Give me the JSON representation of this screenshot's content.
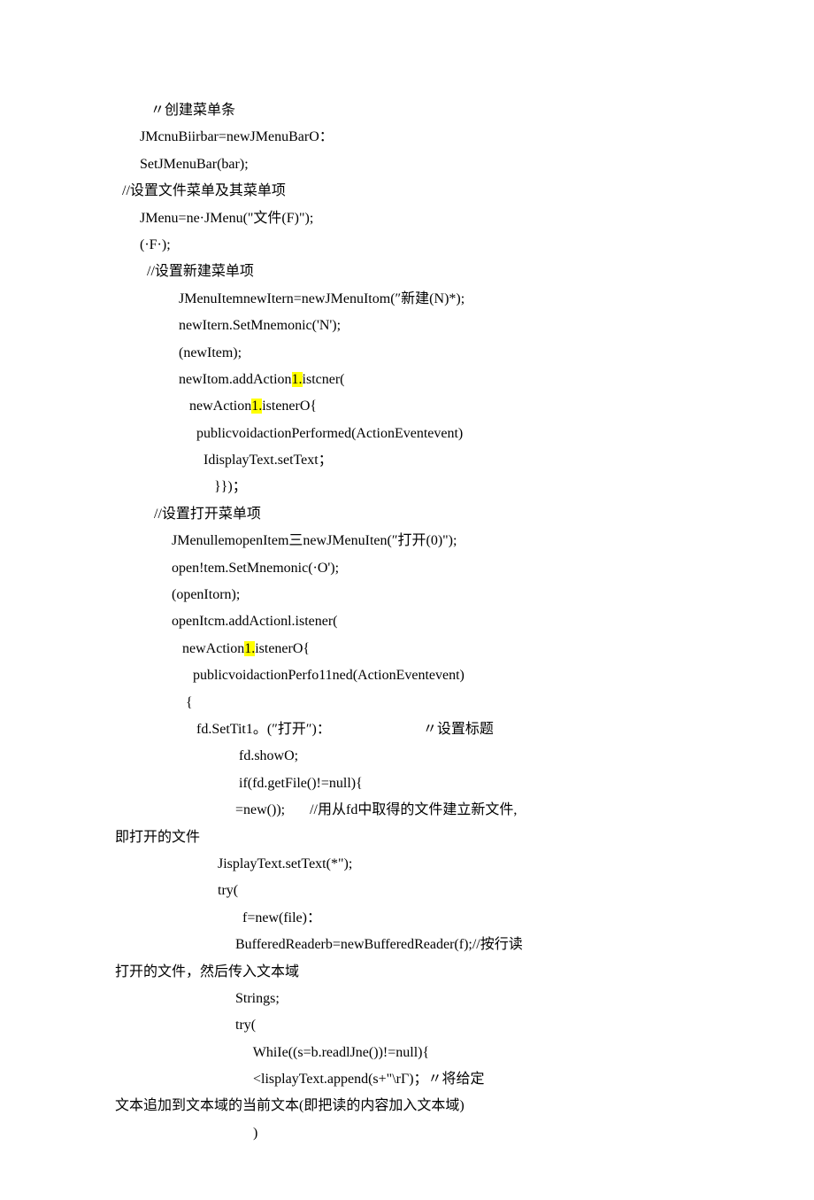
{
  "lines": [
    {
      "indent": "          ",
      "segments": [
        {
          "t": "〃创建菜单条"
        }
      ]
    },
    {
      "indent": "       ",
      "segments": [
        {
          "t": "JMcnuBiirbar=newJMenuBarO："
        }
      ]
    },
    {
      "indent": "       ",
      "segments": [
        {
          "t": "SetJMenuBar(bar);"
        }
      ]
    },
    {
      "indent": "",
      "segments": [
        {
          "t": ""
        }
      ]
    },
    {
      "indent": "  ",
      "segments": [
        {
          "t": "//设置文件菜单及其菜单项"
        }
      ]
    },
    {
      "indent": "       ",
      "segments": [
        {
          "t": "JMenu=ne·JMenu(\"文件(F)\");"
        }
      ]
    },
    {
      "indent": "       ",
      "segments": [
        {
          "t": "(·F·);"
        }
      ]
    },
    {
      "indent": "         ",
      "segments": [
        {
          "t": "//设置新建菜单项"
        }
      ]
    },
    {
      "indent": "                  ",
      "segments": [
        {
          "t": "JMenuItemnewItern=newJMenuItom(″新建(N)*);"
        }
      ]
    },
    {
      "indent": "                  ",
      "segments": [
        {
          "t": "newItern.SetMnemonic('N');"
        }
      ]
    },
    {
      "indent": "                  ",
      "segments": [
        {
          "t": "(newItem);"
        }
      ]
    },
    {
      "indent": "                  ",
      "segments": [
        {
          "t": "newItom.addAction"
        },
        {
          "t": "1.",
          "hl": true
        },
        {
          "t": "istcner("
        }
      ]
    },
    {
      "indent": "                     ",
      "segments": [
        {
          "t": "newAction"
        },
        {
          "t": "1.",
          "hl": true
        },
        {
          "t": "istenerO{"
        }
      ]
    },
    {
      "indent": "                       ",
      "segments": [
        {
          "t": "publicvoidactionPerformed(ActionEventevent)"
        }
      ]
    },
    {
      "indent": "                         ",
      "segments": [
        {
          "t": "IdisplayText.setText；"
        }
      ]
    },
    {
      "indent": "                            ",
      "segments": [
        {
          "t": "}})；"
        }
      ]
    },
    {
      "indent": "           ",
      "segments": [
        {
          "t": "//设置打开菜单项"
        }
      ]
    },
    {
      "indent": "                ",
      "segments": [
        {
          "t": "JMenullemopenItem三newJMenuIten(″打开(0)\");"
        }
      ]
    },
    {
      "indent": "                ",
      "segments": [
        {
          "t": "open!tem.SetMnemonic(·O');"
        }
      ]
    },
    {
      "indent": "                ",
      "segments": [
        {
          "t": "(openItorn);"
        }
      ]
    },
    {
      "indent": "                ",
      "segments": [
        {
          "t": "openItcm.addActionl.istener("
        }
      ]
    },
    {
      "indent": "                   ",
      "segments": [
        {
          "t": "newAction"
        },
        {
          "t": "1.",
          "hl": true
        },
        {
          "t": "istenerO{"
        }
      ]
    },
    {
      "indent": "                      ",
      "segments": [
        {
          "t": "publicvoidactionPerfo11ned(ActionEventevent)"
        }
      ]
    },
    {
      "indent": "                    ",
      "segments": [
        {
          "t": "{"
        }
      ]
    },
    {
      "indent": "                       ",
      "segments": [
        {
          "t": "fd.SetTit1。(″打开″)：                          〃设置标题"
        }
      ]
    },
    {
      "indent": "                                   ",
      "segments": [
        {
          "t": "fd.showO;"
        }
      ]
    },
    {
      "indent": "                                   ",
      "segments": [
        {
          "t": "if(fd.getFile()!=null){"
        }
      ]
    },
    {
      "indent": "                                  ",
      "segments": [
        {
          "t": "=new());       //用从fd中取得的文件建立新文件,"
        }
      ]
    },
    {
      "indent": "",
      "segments": [
        {
          "t": "即打开的文件"
        }
      ]
    },
    {
      "indent": "                             ",
      "segments": [
        {
          "t": "JisplayText.setText(*\");"
        }
      ]
    },
    {
      "indent": "                             ",
      "segments": [
        {
          "t": "try("
        }
      ]
    },
    {
      "indent": "                                    ",
      "segments": [
        {
          "t": "f=new(file)："
        }
      ]
    },
    {
      "indent": "                                  ",
      "segments": [
        {
          "t": "BufferedReaderb=newBufferedReader(f);//按行读"
        }
      ]
    },
    {
      "indent": "",
      "segments": [
        {
          "t": "打开的文件，然后传入文本域"
        }
      ]
    },
    {
      "indent": "                                  ",
      "segments": [
        {
          "t": "Strings;"
        }
      ]
    },
    {
      "indent": "                                  ",
      "segments": [
        {
          "t": "try("
        }
      ]
    },
    {
      "indent": "                                       ",
      "segments": [
        {
          "t": "WhiIe((s=b.readlJne())!=null){"
        }
      ]
    },
    {
      "indent": "                                       ",
      "segments": [
        {
          "t": "<lisplayText.append(s+\"\\rΓ)；〃将给定"
        }
      ]
    },
    {
      "indent": "",
      "segments": [
        {
          "t": "文本追加到文本域的当前文本(即把读的内容加入文本域)"
        }
      ]
    },
    {
      "indent": "                                       ",
      "segments": [
        {
          "t": ")"
        }
      ]
    }
  ]
}
